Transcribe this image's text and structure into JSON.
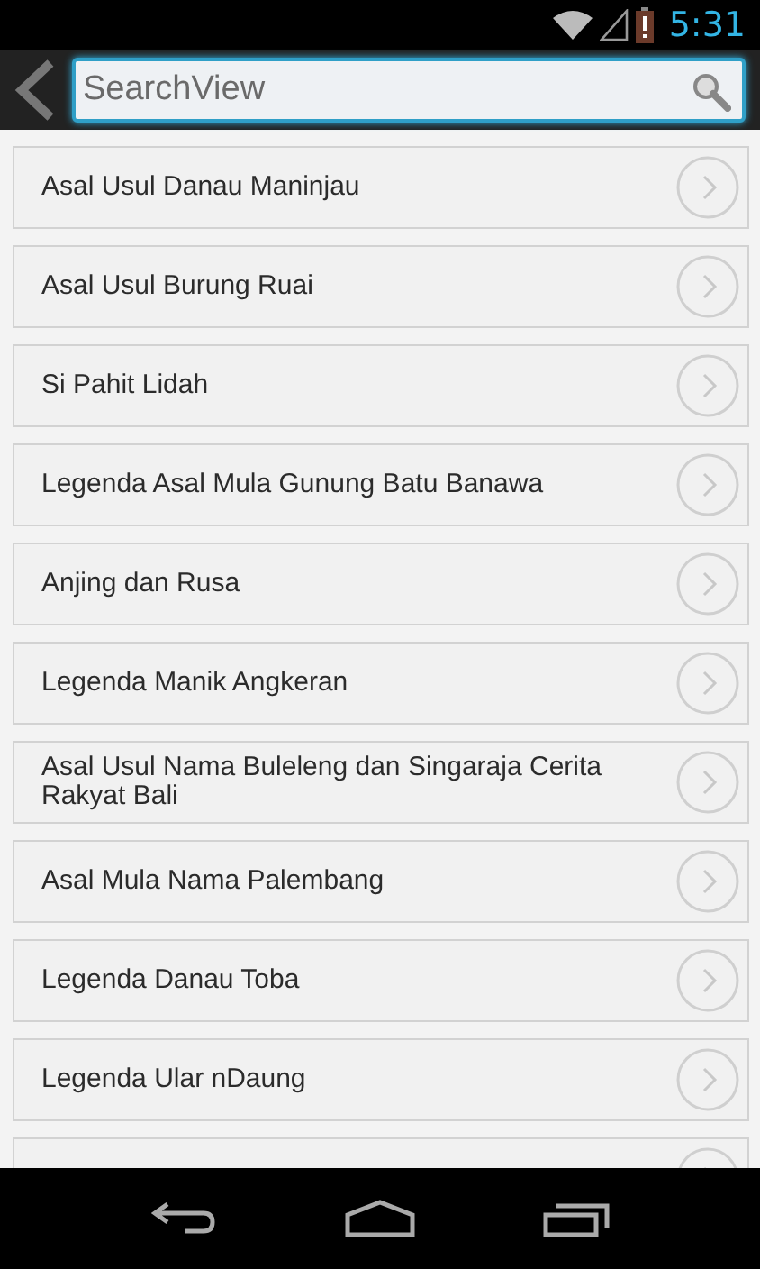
{
  "status_bar": {
    "time": "5:31"
  },
  "action_bar": {
    "search": {
      "placeholder": "SearchView"
    }
  },
  "items": [
    {
      "title": "Asal Usul Danau Maninjau"
    },
    {
      "title": "Asal Usul Burung Ruai"
    },
    {
      "title": "Si Pahit Lidah"
    },
    {
      "title": "Legenda Asal Mula Gunung Batu Banawa"
    },
    {
      "title": "Anjing dan Rusa"
    },
    {
      "title": "Legenda Manik Angkeran"
    },
    {
      "title": "Asal Usul Nama Buleleng dan Singaraja Cerita Rakyat Bali"
    },
    {
      "title": "Asal Mula Nama Palembang"
    },
    {
      "title": "Legenda Danau Toba"
    },
    {
      "title": "Legenda Ular nDaung"
    }
  ]
}
